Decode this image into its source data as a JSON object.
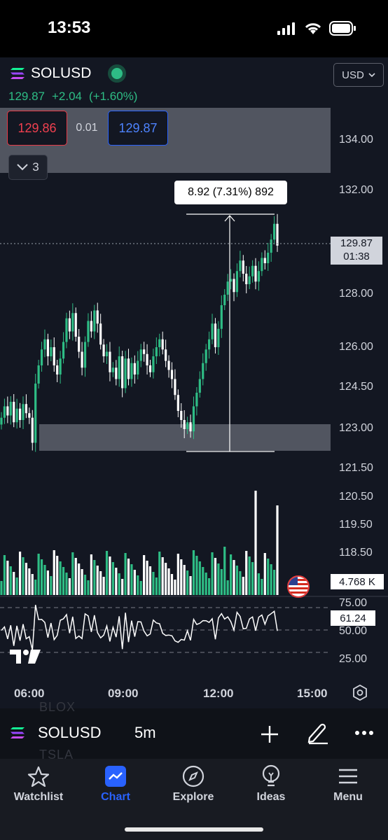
{
  "status_bar": {
    "time": "13:53"
  },
  "header": {
    "symbol": "SOLUSD",
    "currency": "USD",
    "last_price": "129.87",
    "change": "+2.04",
    "change_pct": "(+1.60%)"
  },
  "trade": {
    "sell_price": "129.86",
    "spread": "0.01",
    "buy_price": "129.87"
  },
  "collapse": {
    "count": "3"
  },
  "measure": {
    "label": "8.92 (7.31%) 892"
  },
  "price_tag": {
    "price": "129.87",
    "countdown": "01:38"
  },
  "volume_tag": "4.768 K",
  "rsi_tag": "61.24",
  "price_axis": [
    "134.00",
    "132.00",
    "128.00",
    "126.00",
    "124.50",
    "123.00",
    "121.50",
    "120.50",
    "119.50",
    "118.50"
  ],
  "rsi_axis": [
    "75.00",
    "50.00",
    "25.00"
  ],
  "time_axis": [
    "06:00",
    "09:00",
    "12:00",
    "15:00"
  ],
  "toolbar": {
    "symbol": "SOLUSD",
    "interval": "5m",
    "ghost_top": "BLOX",
    "ghost_bottom": "TSLA"
  },
  "tabs": [
    {
      "label": "Watchlist",
      "icon": "star-icon"
    },
    {
      "label": "Chart",
      "icon": "chart-icon"
    },
    {
      "label": "Explore",
      "icon": "compass-icon"
    },
    {
      "label": "Ideas",
      "icon": "lightbulb-icon"
    },
    {
      "label": "Menu",
      "icon": "menu-icon"
    }
  ],
  "colors": {
    "up": "#2ebd85",
    "down": "#ffffff",
    "background": "#131722",
    "accent": "#2962ff"
  },
  "chart_data": {
    "type": "candlestick",
    "symbol": "SOLUSD",
    "interval": "5m",
    "ylim": [
      118.0,
      135.5
    ],
    "close_series": [
      122.9,
      123.4,
      123.0,
      123.6,
      122.7,
      123.3,
      122.8,
      123.5,
      123.1,
      122.9,
      121.8,
      124.4,
      125.2,
      125.9,
      126.3,
      125.6,
      126.0,
      125.2,
      124.8,
      125.5,
      126.2,
      127.1,
      126.6,
      127.3,
      126.4,
      125.8,
      125.1,
      126.2,
      127.0,
      126.6,
      127.4,
      126.9,
      126.1,
      125.6,
      125.8,
      124.9,
      125.1,
      124.6,
      125.6,
      124.2,
      125.5,
      124.6,
      125.3,
      124.8,
      125.4,
      125.9,
      125.7,
      125.2,
      124.9,
      125.6,
      126.0,
      126.3,
      125.9,
      125.4,
      125.0,
      124.6,
      123.9,
      123.2,
      122.8,
      122.4,
      122.7,
      122.3,
      123.4,
      124.0,
      124.6,
      125.3,
      125.9,
      126.3,
      126.9,
      126.0,
      126.7,
      127.6,
      128.0,
      128.5,
      128.6,
      128.1,
      128.9,
      129.3,
      128.8,
      128.4,
      128.7,
      129.1,
      128.5,
      128.9,
      129.4,
      129.2,
      129.6,
      130.1,
      130.7,
      129.87
    ],
    "volume_max_k": 14.5,
    "last_volume_k": 4.768,
    "rsi_last": 61.24,
    "rsi_levels": [
      75,
      50,
      25
    ]
  }
}
